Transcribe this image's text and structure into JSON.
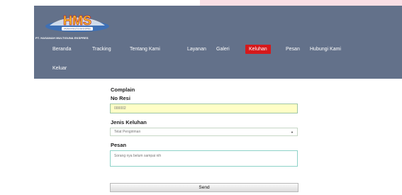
{
  "header": {
    "logo_text": "HMS",
    "logo_tagline": "HASANAH MULTIGUNA EKSPRES",
    "company_name": "PT. HASANAH MULTIGUNA EKSPRES"
  },
  "nav": [
    {
      "label": "Beranda"
    },
    {
      "label": "Tracking"
    },
    {
      "label": "Tentang Kami"
    },
    {
      "label": "Layanan"
    },
    {
      "label": "Galeri"
    },
    {
      "label": "Keluhan",
      "active": true
    },
    {
      "label": "Pesan"
    },
    {
      "label": "Hubungi Kami"
    },
    {
      "label": "Keluar"
    }
  ],
  "form": {
    "heading": "Complain",
    "resi_label": "No Resi",
    "resi_value": "000002",
    "jenis_label": "Jenis Keluhan",
    "jenis_value": "Telat Pengiriman",
    "pesan_label": "Pesan",
    "pesan_value": "Sorang nya belum sampai nih",
    "send_label": "Send"
  },
  "colors": {
    "header_bg": "#63718a",
    "active_nav": "#d6191b",
    "pink_strip": "#f9dfe5",
    "resi_bg": "#fffec6"
  }
}
